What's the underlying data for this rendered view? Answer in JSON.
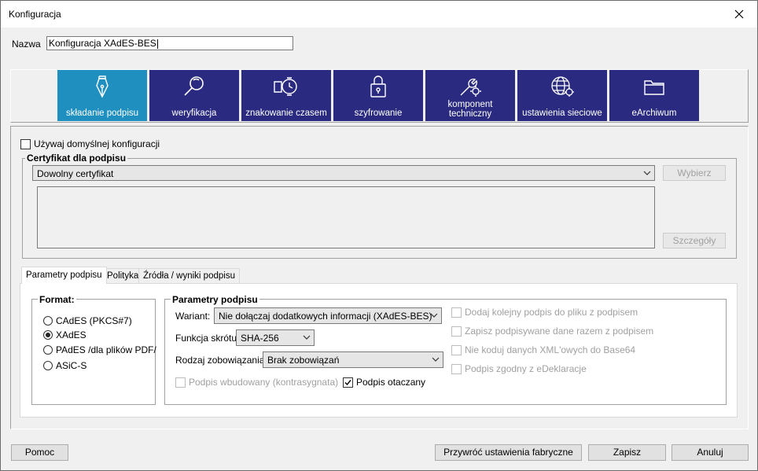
{
  "window": {
    "title": "Konfiguracja"
  },
  "name_field": {
    "label": "Nazwa",
    "value": "Konfiguracja XAdES-BES"
  },
  "tiles": [
    {
      "label": "składanie podpisu",
      "icon": "pen-nib-icon",
      "active": true
    },
    {
      "label": "weryfikacja",
      "icon": "magnifier-icon"
    },
    {
      "label": "znakowanie czasem",
      "icon": "clock-icon"
    },
    {
      "label": "szyfrowanie",
      "icon": "lock-icon"
    },
    {
      "label": "komponent techniczny",
      "icon": "wrench-gear-icon"
    },
    {
      "label": "ustawienia sieciowe",
      "icon": "globe-gear-icon"
    },
    {
      "label": "eArchiwum",
      "icon": "folder-icon"
    }
  ],
  "use_default": {
    "label": "Używaj domyślnej konfiguracji",
    "checked": false
  },
  "certificate": {
    "legend": "Certyfikat dla podpisu",
    "selected": "Dowolny certyfikat",
    "choose_button": "Wybierz",
    "details_button": "Szczegóły"
  },
  "subtabs": [
    {
      "label": "Parametry podpisu",
      "active": true
    },
    {
      "label": "Polityka"
    },
    {
      "label": "Źródła / wyniki podpisu"
    }
  ],
  "format": {
    "legend": "Format:",
    "options": [
      {
        "label": "CAdES (PKCS#7)",
        "selected": false
      },
      {
        "label": "XAdES",
        "selected": true
      },
      {
        "label": "PAdES /dla plików PDF/",
        "selected": false
      },
      {
        "label": "ASiC-S",
        "selected": false
      }
    ]
  },
  "params": {
    "legend": "Parametry podpisu",
    "variant_label": "Wariant:",
    "variant_value": "Nie dołączaj dodatkowych informacji (XAdES-BES)",
    "hash_label": "Funkcja skrótu:",
    "hash_value": "SHA-256",
    "commitment_label": "Rodzaj zobowiązania:",
    "commitment_value": "Brak zobowiązań",
    "embedded_label": "Podpis wbudowany (kontrasygnata)",
    "enveloping_label": "Podpis otaczany"
  },
  "options": [
    {
      "label": "Dodaj kolejny podpis do pliku z podpisem"
    },
    {
      "label": "Zapisz podpisywane dane razem z podpisem"
    },
    {
      "label": "Nie koduj danych XML'owych do Base64"
    },
    {
      "label": "Podpis zgodny z eDeklaracje"
    }
  ],
  "footer": {
    "help": "Pomoc",
    "restore": "Przywróć ustawienia fabryczne",
    "save": "Zapisz",
    "cancel": "Anuluj"
  },
  "colors": {
    "tile": "#2a2a80",
    "tile_active": "#1e8fbf"
  }
}
